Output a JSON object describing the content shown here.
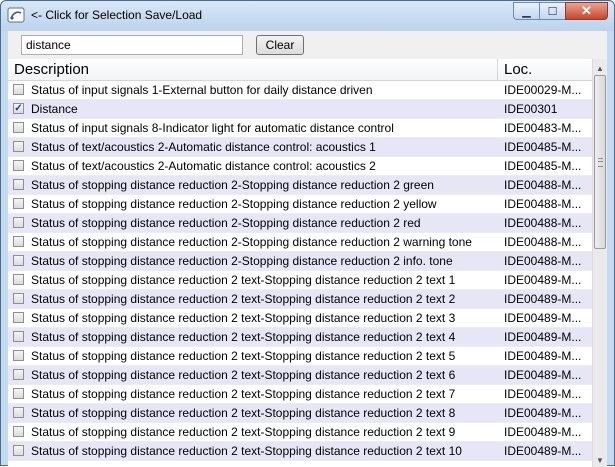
{
  "window": {
    "title": "<- Click for Selection Save/Load",
    "minimize_icon": "minimize-icon",
    "maximize_icon": "maximize-icon",
    "close_icon": "close-icon"
  },
  "search": {
    "value": "distance",
    "clear_label": "Clear"
  },
  "table": {
    "columns": {
      "description": "Description",
      "location": "Loc."
    },
    "rows": [
      {
        "checked": false,
        "description": "Status of input signals 1-External button for daily distance driven",
        "loc": "IDE00029-M..."
      },
      {
        "checked": true,
        "description": "Distance",
        "loc": "IDE00301"
      },
      {
        "checked": false,
        "description": "Status of input signals 8-Indicator light for automatic distance control",
        "loc": "IDE00483-M..."
      },
      {
        "checked": false,
        "description": "Status of text/acoustics 2-Automatic distance control: acoustics 1",
        "loc": "IDE00485-M..."
      },
      {
        "checked": false,
        "description": "Status of text/acoustics 2-Automatic distance control: acoustics 2",
        "loc": "IDE00485-M..."
      },
      {
        "checked": false,
        "description": "Status of stopping distance reduction 2-Stopping distance reduction 2 green",
        "loc": "IDE00488-M..."
      },
      {
        "checked": false,
        "description": "Status of stopping distance reduction 2-Stopping distance reduction 2 yellow",
        "loc": "IDE00488-M..."
      },
      {
        "checked": false,
        "description": "Status of stopping distance reduction 2-Stopping distance reduction 2 red",
        "loc": "IDE00488-M..."
      },
      {
        "checked": false,
        "description": "Status of stopping distance reduction 2-Stopping distance reduction 2 warning tone",
        "loc": "IDE00488-M..."
      },
      {
        "checked": false,
        "description": "Status of stopping distance reduction 2-Stopping distance reduction 2 info. tone",
        "loc": "IDE00488-M..."
      },
      {
        "checked": false,
        "description": "Status of stopping distance reduction 2 text-Stopping distance reduction 2 text 1",
        "loc": "IDE00489-M..."
      },
      {
        "checked": false,
        "description": "Status of stopping distance reduction 2 text-Stopping distance reduction 2 text 2",
        "loc": "IDE00489-M..."
      },
      {
        "checked": false,
        "description": "Status of stopping distance reduction 2 text-Stopping distance reduction 2 text 3",
        "loc": "IDE00489-M..."
      },
      {
        "checked": false,
        "description": "Status of stopping distance reduction 2 text-Stopping distance reduction 2 text 4",
        "loc": "IDE00489-M..."
      },
      {
        "checked": false,
        "description": "Status of stopping distance reduction 2 text-Stopping distance reduction 2 text 5",
        "loc": "IDE00489-M..."
      },
      {
        "checked": false,
        "description": "Status of stopping distance reduction 2 text-Stopping distance reduction 2 text 6",
        "loc": "IDE00489-M..."
      },
      {
        "checked": false,
        "description": "Status of stopping distance reduction 2 text-Stopping distance reduction 2 text 7",
        "loc": "IDE00489-M..."
      },
      {
        "checked": false,
        "description": "Status of stopping distance reduction 2 text-Stopping distance reduction 2 text 8",
        "loc": "IDE00489-M..."
      },
      {
        "checked": false,
        "description": "Status of stopping distance reduction 2 text-Stopping distance reduction 2 text 9",
        "loc": "IDE00489-M..."
      },
      {
        "checked": false,
        "description": "Status of stopping distance reduction 2 text-Stopping distance reduction 2 text 10",
        "loc": "IDE00489-M..."
      }
    ]
  },
  "colors": {
    "alt_row": "#e6e6f6",
    "title_bar": "#c5d9ef",
    "close_button": "#c9452b"
  }
}
